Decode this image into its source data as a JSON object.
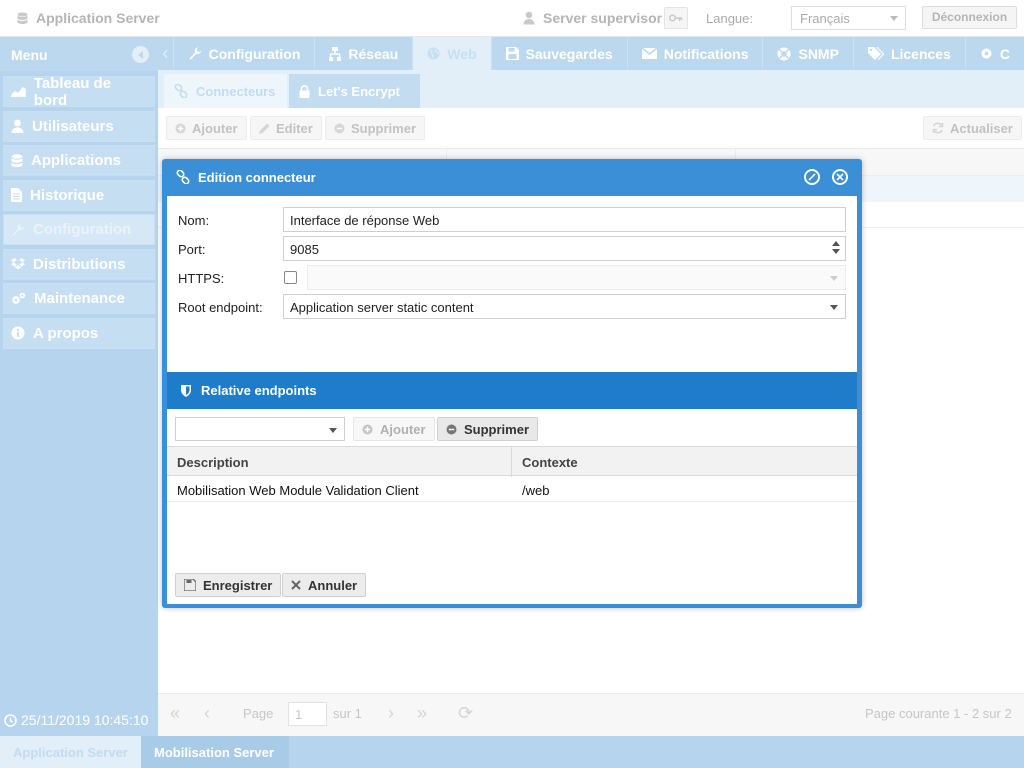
{
  "app": {
    "title": "Application Server"
  },
  "topbar": {
    "supervisor": "Server supervisor",
    "language_label": "Langue:",
    "language_value": "Français",
    "logout": "Déconnexion"
  },
  "sidebar": {
    "menu_label": "Menu",
    "items": [
      {
        "label": "Tableau de bord",
        "icon": "chart-icon"
      },
      {
        "label": "Utilisateurs",
        "icon": "user-icon"
      },
      {
        "label": "Applications",
        "icon": "database-icon"
      },
      {
        "label": "Historique",
        "icon": "document-icon"
      },
      {
        "label": "Configuration",
        "icon": "wrench-icon",
        "active": true
      },
      {
        "label": "Distributions",
        "icon": "dropbox-icon"
      },
      {
        "label": "Maintenance",
        "icon": "gears-icon"
      },
      {
        "label": "A propos",
        "icon": "info-icon"
      }
    ],
    "datetime": "25/11/2019 10:45:10"
  },
  "tabs": [
    {
      "label": "Configuration",
      "icon": "wrench-icon"
    },
    {
      "label": "Réseau",
      "icon": "network-icon"
    },
    {
      "label": "Web",
      "icon": "globe-icon",
      "active": true
    },
    {
      "label": "Sauvegardes",
      "icon": "save-icon"
    },
    {
      "label": "Notifications",
      "icon": "envelope-icon"
    },
    {
      "label": "SNMP",
      "icon": "lifebuoy-icon"
    },
    {
      "label": "Licences",
      "icon": "tags-icon"
    },
    {
      "label": "C",
      "icon": "gear-icon"
    }
  ],
  "subtabs": [
    {
      "label": "Connecteurs",
      "icon": "link-icon",
      "active": true
    },
    {
      "label": "Let's Encrypt",
      "icon": "lock-icon"
    }
  ],
  "toolbar": {
    "add": "Ajouter",
    "edit": "Editer",
    "delete": "Supprimer",
    "refresh": "Actualiser"
  },
  "pager": {
    "page_label": "Page",
    "page_value": "1",
    "of_label": "sur 1",
    "summary": "Page courante 1 - 2 sur 2"
  },
  "bottom_tabs": [
    {
      "label": "Application Server",
      "active": true
    },
    {
      "label": "Mobilisation Server"
    }
  ],
  "dialog": {
    "title": "Edition connecteur",
    "fields": {
      "name_label": "Nom:",
      "name_value": "Interface de réponse Web",
      "port_label": "Port:",
      "port_value": "9085",
      "https_label": "HTTPS:",
      "https_checked": false,
      "root_label": "Root endpoint:",
      "root_value": "Application server static content"
    },
    "relative_title": "Relative endpoints",
    "rel_add": "Ajouter",
    "rel_delete": "Supprimer",
    "table": {
      "columns": [
        "Description",
        "Contexte"
      ],
      "rows": [
        {
          "description": "Mobilisation Web Module Validation Client",
          "context": "/web"
        }
      ]
    },
    "save": "Enregistrer",
    "cancel": "Annuler"
  }
}
